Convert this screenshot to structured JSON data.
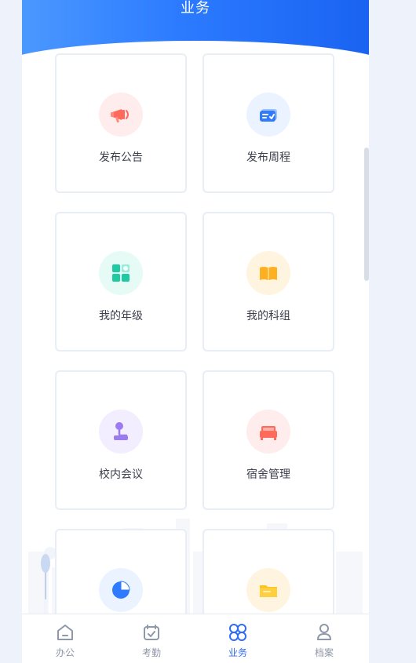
{
  "header": {
    "title": "业务"
  },
  "cards": [
    {
      "label": "发布公告",
      "icon": "megaphone-icon",
      "color": "#ff6a5a",
      "bg": "#ffecec"
    },
    {
      "label": "发布周程",
      "icon": "calendar-card-icon",
      "color": "#2f7bff",
      "bg": "#eaf3ff"
    },
    {
      "label": "我的年级",
      "icon": "grade-grid-icon",
      "color": "#1fc9a2",
      "bg": "#e7fbf6"
    },
    {
      "label": "我的科组",
      "icon": "book-icon",
      "color": "#ffb020",
      "bg": "#fff4df"
    },
    {
      "label": "校内会议",
      "icon": "microphone-icon",
      "color": "#9b7cf0",
      "bg": "#f2edff"
    },
    {
      "label": "宿舍管理",
      "icon": "bed-icon",
      "color": "#ff6a5a",
      "bg": "#ffecec"
    },
    {
      "label": "",
      "icon": "pie-chart-icon",
      "color": "#2f7bff",
      "bg": "#eaf3ff"
    },
    {
      "label": "",
      "icon": "folder-icon",
      "color": "#ffc21a",
      "bg": "#fff4df"
    }
  ],
  "tabbar": {
    "items": [
      {
        "label": "办公",
        "icon": "home-icon",
        "active": false
      },
      {
        "label": "考勤",
        "icon": "calendar-check-icon",
        "active": false
      },
      {
        "label": "业务",
        "icon": "apps-icon",
        "active": true
      },
      {
        "label": "档案",
        "icon": "profile-icon",
        "active": false
      }
    ]
  }
}
